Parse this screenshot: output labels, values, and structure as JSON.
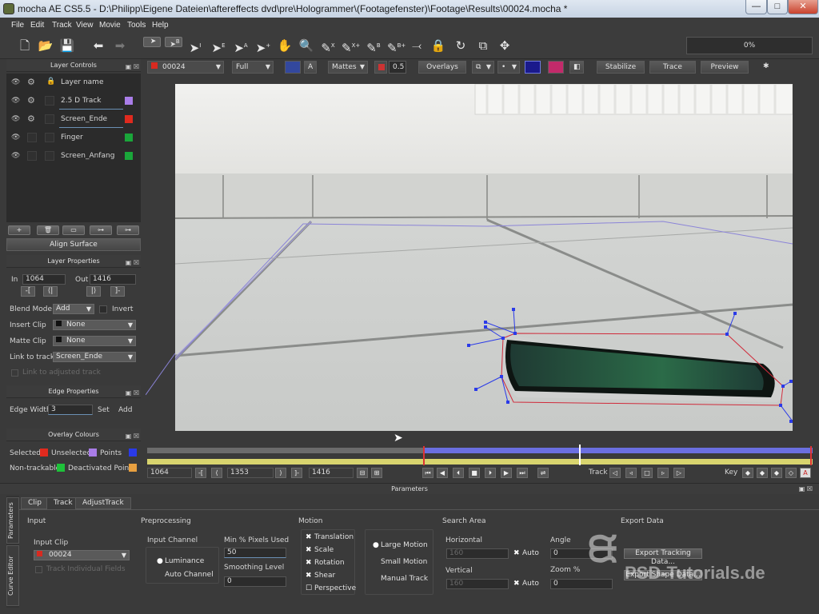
{
  "titlebar": {
    "title": "mocha AE CS5.5 - D:\\Philipp\\Eigene Dateien\\aftereffects dvd\\pre\\Hologrammer\\(Footagefenster)\\Footage\\Results\\00024.mocha *",
    "minimize": "—",
    "maximize": "□",
    "close": "✕"
  },
  "menu": [
    "File",
    "Edit",
    "Track",
    "View",
    "Movie",
    "Tools",
    "Help"
  ],
  "progress": "0%",
  "viewer_bar": {
    "clip": "00024",
    "clip_color": "#d82a20",
    "resolution": "Full",
    "mattes": "Mattes",
    "opacity": "0.5",
    "overlays": "Overlays",
    "stabilize": "Stabilize",
    "trace": "Trace",
    "preview": "Preview"
  },
  "layer_controls": {
    "title": "Layer Controls",
    "header": "Layer name",
    "layers": [
      {
        "name": "2.5 D Track",
        "color": "#a97de8"
      },
      {
        "name": "Screen_Ende",
        "color": "#e02a1e"
      },
      {
        "name": "Finger",
        "color": "#1aa63a"
      },
      {
        "name": "Screen_Anfang",
        "color": "#1aa63a"
      }
    ],
    "align_surface": "Align Surface"
  },
  "layer_properties": {
    "title": "Layer Properties",
    "in_label": "In",
    "in_value": "1064",
    "out_label": "Out",
    "out_value": "1416",
    "blend_mode_label": "Blend Mode",
    "blend_mode": "Add",
    "invert": "Invert",
    "insert_clip_label": "Insert Clip",
    "insert_clip": "None",
    "matte_clip_label": "Matte Clip",
    "matte_clip": "None",
    "link_label": "Link to track",
    "link": "Screen_Ende",
    "link_adjusted": "Link to adjusted track"
  },
  "edge_properties": {
    "title": "Edge Properties",
    "edge_width_label": "Edge Width",
    "edge_width": "3",
    "set": "Set",
    "add": "Add"
  },
  "overlay_colours": {
    "title": "Overlay Colours",
    "selected": "Selected",
    "unselected": "Unselected",
    "points": "Points",
    "non_trackable": "Non-trackable",
    "deactivated_points": "Deactivated Points",
    "colors": {
      "selected": "#e02a1e",
      "unselected": "#a97de8",
      "points": "#2a3ae8",
      "non_trackable": "#1ec23a",
      "deactivated": "#e8a040"
    }
  },
  "timeline": {
    "start": "1064",
    "current": "1353",
    "end": "1416",
    "track_label": "Track",
    "key_label": "Key",
    "playhead_fraction": 0.4
  },
  "params": {
    "title": "Parameters",
    "side_tabs": [
      "Parameters",
      "Curve Editor"
    ],
    "tabs": [
      "Clip",
      "Track",
      "AdjustTrack"
    ],
    "active_tab": "Track",
    "input": {
      "title": "Input",
      "input_clip_label": "Input Clip",
      "input_clip": "00024",
      "track_individual_fields": "Track Individual Fields"
    },
    "preprocessing": {
      "title": "Preprocessing",
      "input_channel_label": "Input Channel",
      "luminance": "Luminance",
      "auto_channel": "Auto Channel",
      "min_pixels_label": "Min % Pixels Used",
      "min_pixels": "50",
      "smoothing_label": "Smoothing Level",
      "smoothing": "0"
    },
    "motion": {
      "title": "Motion",
      "translation": "Translation",
      "scale": "Scale",
      "rotation": "Rotation",
      "shear": "Shear",
      "perspective": "Perspective",
      "large_motion": "Large Motion",
      "small_motion": "Small Motion",
      "manual_track": "Manual Track"
    },
    "search_area": {
      "title": "Search Area",
      "horizontal_label": "Horizontal",
      "horizontal": "160",
      "vertical_label": "Vertical",
      "vertical": "160",
      "auto": "Auto",
      "angle_label": "Angle",
      "angle": "0",
      "zoom_label": "Zoom %",
      "zoom": "0"
    },
    "export": {
      "title": "Export Data",
      "tracking": "Export Tracking Data...",
      "shape": "Export Shape Data..."
    }
  },
  "watermark": "PSD-Tutorials.de"
}
